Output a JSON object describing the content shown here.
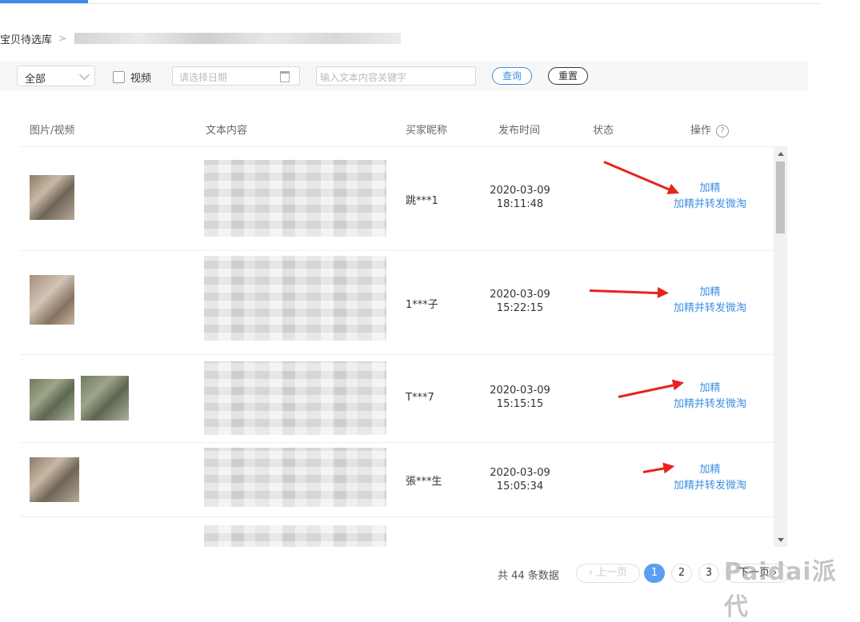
{
  "breadcrumb": {
    "root": "宝贝待选库",
    "separator": ">"
  },
  "filters": {
    "category_select": "全部",
    "video_checkbox_label": "视频",
    "date_placeholder": "请选择日期",
    "keyword_placeholder": "输入文本内容关键字",
    "query_button": "查询",
    "reset_button": "重置"
  },
  "table": {
    "columns": [
      "图片/视频",
      "文本内容",
      "买家昵称",
      "发布时间",
      "状态",
      "操作"
    ],
    "rows": [
      {
        "nickname": "跳***1",
        "date": "2020-03-09",
        "time": "18:11:48",
        "action_primary": "加精",
        "action_secondary": "加精并转发微淘"
      },
      {
        "nickname": "1***子",
        "date": "2020-03-09",
        "time": "15:22:15",
        "action_primary": "加精",
        "action_secondary": "加精并转发微淘"
      },
      {
        "nickname": "T***7",
        "date": "2020-03-09",
        "time": "15:15:15",
        "action_primary": "加精",
        "action_secondary": "加精并转发微淘"
      },
      {
        "nickname": "張***生",
        "date": "2020-03-09",
        "time": "15:05:34",
        "action_primary": "加精",
        "action_secondary": "加精并转发微淘"
      }
    ]
  },
  "pagination": {
    "total_text": "共 44 条数据",
    "prev": "‹ 上一页",
    "pages": [
      "1",
      "2",
      "3"
    ],
    "current": "1",
    "next": "下一页 ›"
  },
  "watermark": "Paidai派代",
  "colors": {
    "link": "#3c8fe3",
    "annotation_arrow": "#e8231f",
    "active_page": "#5b9ff0"
  }
}
